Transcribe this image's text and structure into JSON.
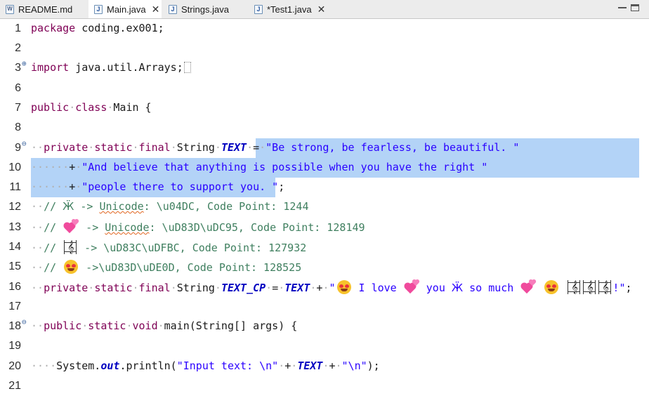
{
  "tabs": [
    {
      "label": "README.md",
      "icon": "markdown-file-icon",
      "active": false
    },
    {
      "label": "Main.java",
      "icon": "java-file-icon",
      "active": true,
      "close": "✕"
    },
    {
      "label": "Strings.java",
      "icon": "java-file-icon",
      "active": false
    },
    {
      "label": "*Test1.java",
      "icon": "java-file-icon",
      "active": false,
      "close": "✕"
    }
  ],
  "editor": {
    "lines": [
      {
        "n": "1",
        "t": {
          "kw": "package",
          "rest": " coding.ex001;"
        }
      },
      {
        "n": "2"
      },
      {
        "n": "3",
        "t": {
          "kw": "import",
          "rest": " java.util.Arrays;"
        }
      },
      {
        "n": "6"
      },
      {
        "n": "7",
        "t": {
          "kw1": "public",
          "kw2": "class",
          "rest": "Main {"
        }
      },
      {
        "n": "8"
      },
      {
        "n": "9",
        "t": {
          "kw1": "private",
          "kw2": "static",
          "kw3": "final",
          "type": "String",
          "field": "TEXT",
          "eq": "=",
          "str": "\"Be strong, be fearless, be beautiful. \""
        }
      },
      {
        "n": "10",
        "t": {
          "op": "+",
          "str": "\"And believe that anything is possible when you have the right \""
        }
      },
      {
        "n": "11",
        "t": {
          "op": "+",
          "str": "\"people there to support you. \"",
          "end": ";"
        }
      },
      {
        "n": "12",
        "t": {
          "c1": "// ",
          "cyr": "Ӝ",
          "c2": " -> ",
          "u": "Unicode",
          "c3": ": \\u04DC, Code Point: 1244"
        }
      },
      {
        "n": "13",
        "t": {
          "c1": "// ",
          "c2": " -> ",
          "u": "Unicode",
          "c3": ": \\uD83D\\uDC95, Code Point: 128149"
        }
      },
      {
        "n": "14",
        "t": {
          "c1": "// ",
          "c2": " -> \\uD83C\\uDFBC, Code Point: 127932"
        }
      },
      {
        "n": "15",
        "t": {
          "c1": "// ",
          "c2": " ->\\uD83D\\uDE0D, Code Point: 128525"
        }
      },
      {
        "n": "16",
        "t": {
          "kw1": "private",
          "kw2": "static",
          "kw3": "final",
          "type": "String",
          "field": "TEXT_CP",
          "eq": "=",
          "field2": "TEXT",
          "plus": "+",
          "q": "\"",
          "s1": " I love ",
          "s2": " you ",
          "cyr": "Ӝ",
          "s3": " so much ",
          "s4": "!\"",
          "end": ";"
        }
      },
      {
        "n": "17"
      },
      {
        "n": "18",
        "t": {
          "kw1": "public",
          "kw2": "static",
          "kw3": "void",
          "rest": "main(String[] args) {"
        }
      },
      {
        "n": "19"
      },
      {
        "n": "20",
        "t": {
          "a": "System.",
          "out": "out",
          "b": ".println(",
          "s": "\"Input text: \\n\"",
          "plus1": "+",
          "field": "TEXT",
          "plus2": "+",
          "s2": "\"\\n\"",
          "c": ");"
        }
      },
      {
        "n": "21"
      }
    ]
  },
  "colors": {
    "keyword": "#7f0055",
    "string": "#2a00ff",
    "field": "#0000c0",
    "comment": "#3f7f5f",
    "selection": "#b3d3f7"
  },
  "icons": [
    "markdown-file-icon",
    "java-file-icon",
    "close-icon",
    "minimize-icon",
    "maximize-icon",
    "fold-plus-icon",
    "fold-minus-icon"
  ]
}
